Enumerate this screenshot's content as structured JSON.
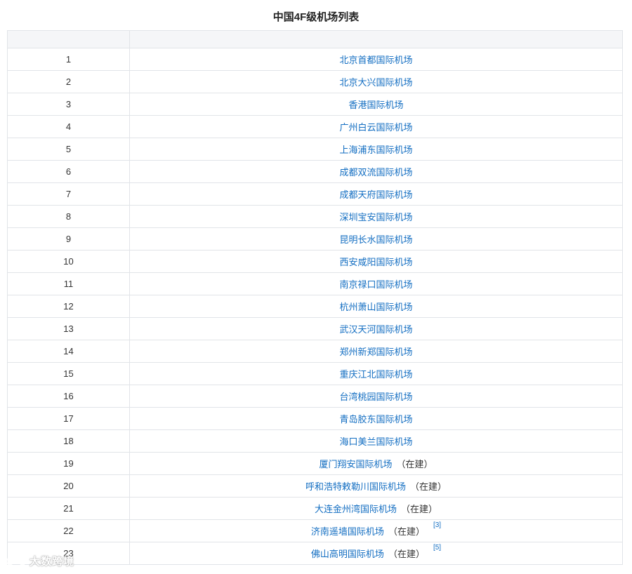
{
  "title": "中国4F级机场列表",
  "table": {
    "header": [
      "",
      ""
    ],
    "rows": [
      {
        "num": "1",
        "name": "北京首都国际机场",
        "status": "",
        "ref": ""
      },
      {
        "num": "2",
        "name": "北京大兴国际机场",
        "status": "",
        "ref": ""
      },
      {
        "num": "3",
        "name": "香港国际机场",
        "status": "",
        "ref": ""
      },
      {
        "num": "4",
        "name": "广州白云国际机场",
        "status": "",
        "ref": ""
      },
      {
        "num": "5",
        "name": "上海浦东国际机场",
        "status": "",
        "ref": ""
      },
      {
        "num": "6",
        "name": "成都双流国际机场",
        "status": "",
        "ref": ""
      },
      {
        "num": "7",
        "name": "成都天府国际机场",
        "status": "",
        "ref": ""
      },
      {
        "num": "8",
        "name": "深圳宝安国际机场",
        "status": "",
        "ref": ""
      },
      {
        "num": "9",
        "name": "昆明长水国际机场",
        "status": "",
        "ref": ""
      },
      {
        "num": "10",
        "name": "西安咸阳国际机场",
        "status": "",
        "ref": ""
      },
      {
        "num": "11",
        "name": "南京禄口国际机场",
        "status": "",
        "ref": ""
      },
      {
        "num": "12",
        "name": "杭州萧山国际机场",
        "status": "",
        "ref": ""
      },
      {
        "num": "13",
        "name": "武汉天河国际机场",
        "status": "",
        "ref": ""
      },
      {
        "num": "14",
        "name": "郑州新郑国际机场",
        "status": "",
        "ref": ""
      },
      {
        "num": "15",
        "name": "重庆江北国际机场",
        "status": "",
        "ref": ""
      },
      {
        "num": "16",
        "name": "台湾桃园国际机场",
        "status": "",
        "ref": ""
      },
      {
        "num": "17",
        "name": "青岛胶东国际机场",
        "status": "",
        "ref": ""
      },
      {
        "num": "18",
        "name": "海口美兰国际机场",
        "status": "",
        "ref": ""
      },
      {
        "num": "19",
        "name": "厦门翔安国际机场",
        "status": "（在建）",
        "ref": ""
      },
      {
        "num": "20",
        "name": "呼和浩特敕勒川国际机场",
        "status": "（在建）",
        "ref": ""
      },
      {
        "num": "21",
        "name": "大连金州湾国际机场",
        "status": "（在建）",
        "ref": ""
      },
      {
        "num": "22",
        "name": "济南遥墙国际机场",
        "status": "（在建）",
        "ref": "[3]"
      },
      {
        "num": "23",
        "name": "佛山高明国际机场",
        "status": "（在建）",
        "ref": "[5]"
      }
    ]
  },
  "watermark": {
    "text": "大数跨境",
    "icon": "watermark-logo-icon"
  }
}
